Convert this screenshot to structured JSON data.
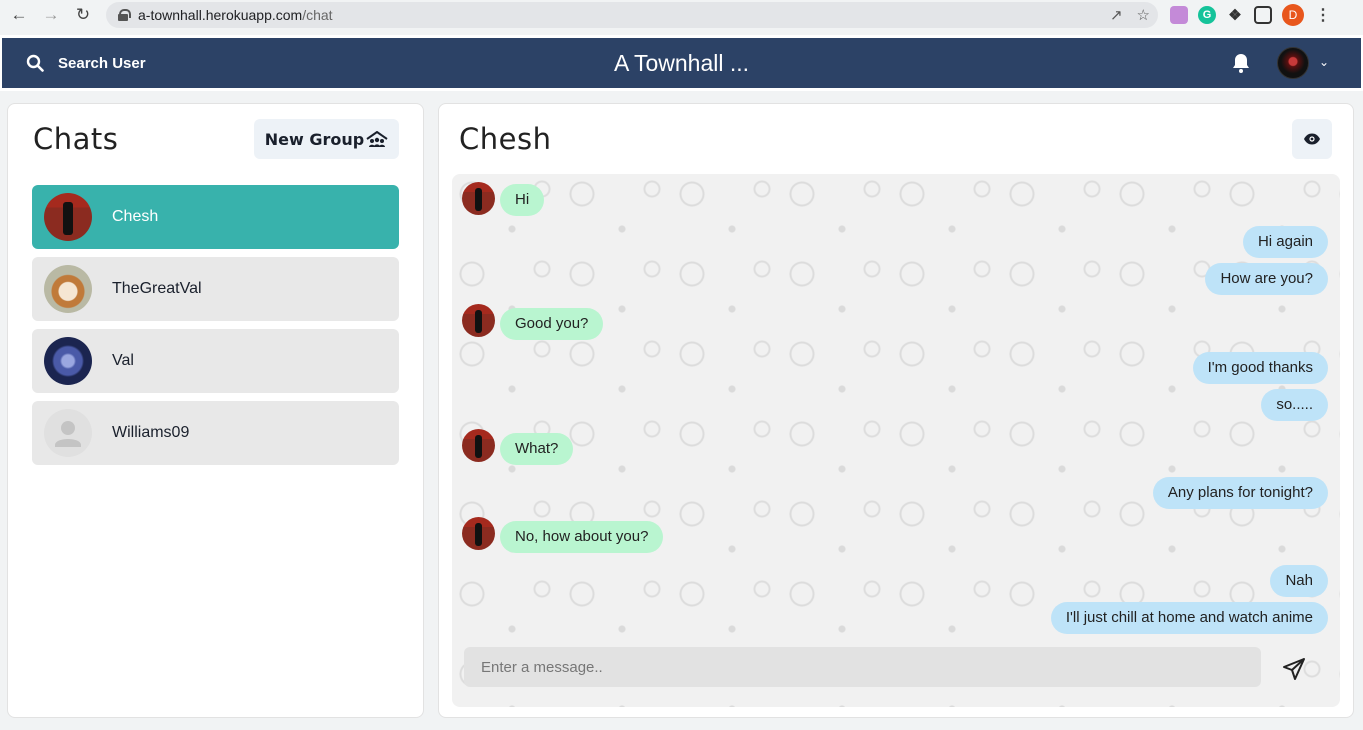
{
  "browser": {
    "url_host": "a-townhall.herokuapp.com",
    "url_path": "/chat",
    "profile_initial": "D"
  },
  "header": {
    "search_label": "Search User",
    "title": "A Townhall ..."
  },
  "chats": {
    "title": "Chats",
    "new_group_label": "New Group",
    "items": [
      {
        "name": "Chesh",
        "active": true
      },
      {
        "name": "TheGreatVal",
        "active": false
      },
      {
        "name": "Val",
        "active": false
      },
      {
        "name": "Williams09",
        "active": false
      }
    ]
  },
  "conversation": {
    "title": "Chesh",
    "messages": [
      {
        "text": "Hi",
        "direction": "in"
      },
      {
        "text": "Hi again",
        "direction": "out"
      },
      {
        "text": "How are you?",
        "direction": "out"
      },
      {
        "text": "Good you?",
        "direction": "in"
      },
      {
        "text": "I'm good thanks",
        "direction": "out"
      },
      {
        "text": "so.....",
        "direction": "out"
      },
      {
        "text": "What?",
        "direction": "in"
      },
      {
        "text": "Any plans for tonight?",
        "direction": "out"
      },
      {
        "text": "No, how about you?",
        "direction": "in"
      },
      {
        "text": "Nah",
        "direction": "out"
      },
      {
        "text": "I'll just chill at home and watch anime",
        "direction": "out"
      }
    ],
    "composer_placeholder": "Enter a message.."
  },
  "colors": {
    "header_bg": "#2c4266",
    "active_chat": "#38b2ac",
    "incoming_bubble": "#b9f5d0",
    "outgoing_bubble": "#bee3f8"
  }
}
